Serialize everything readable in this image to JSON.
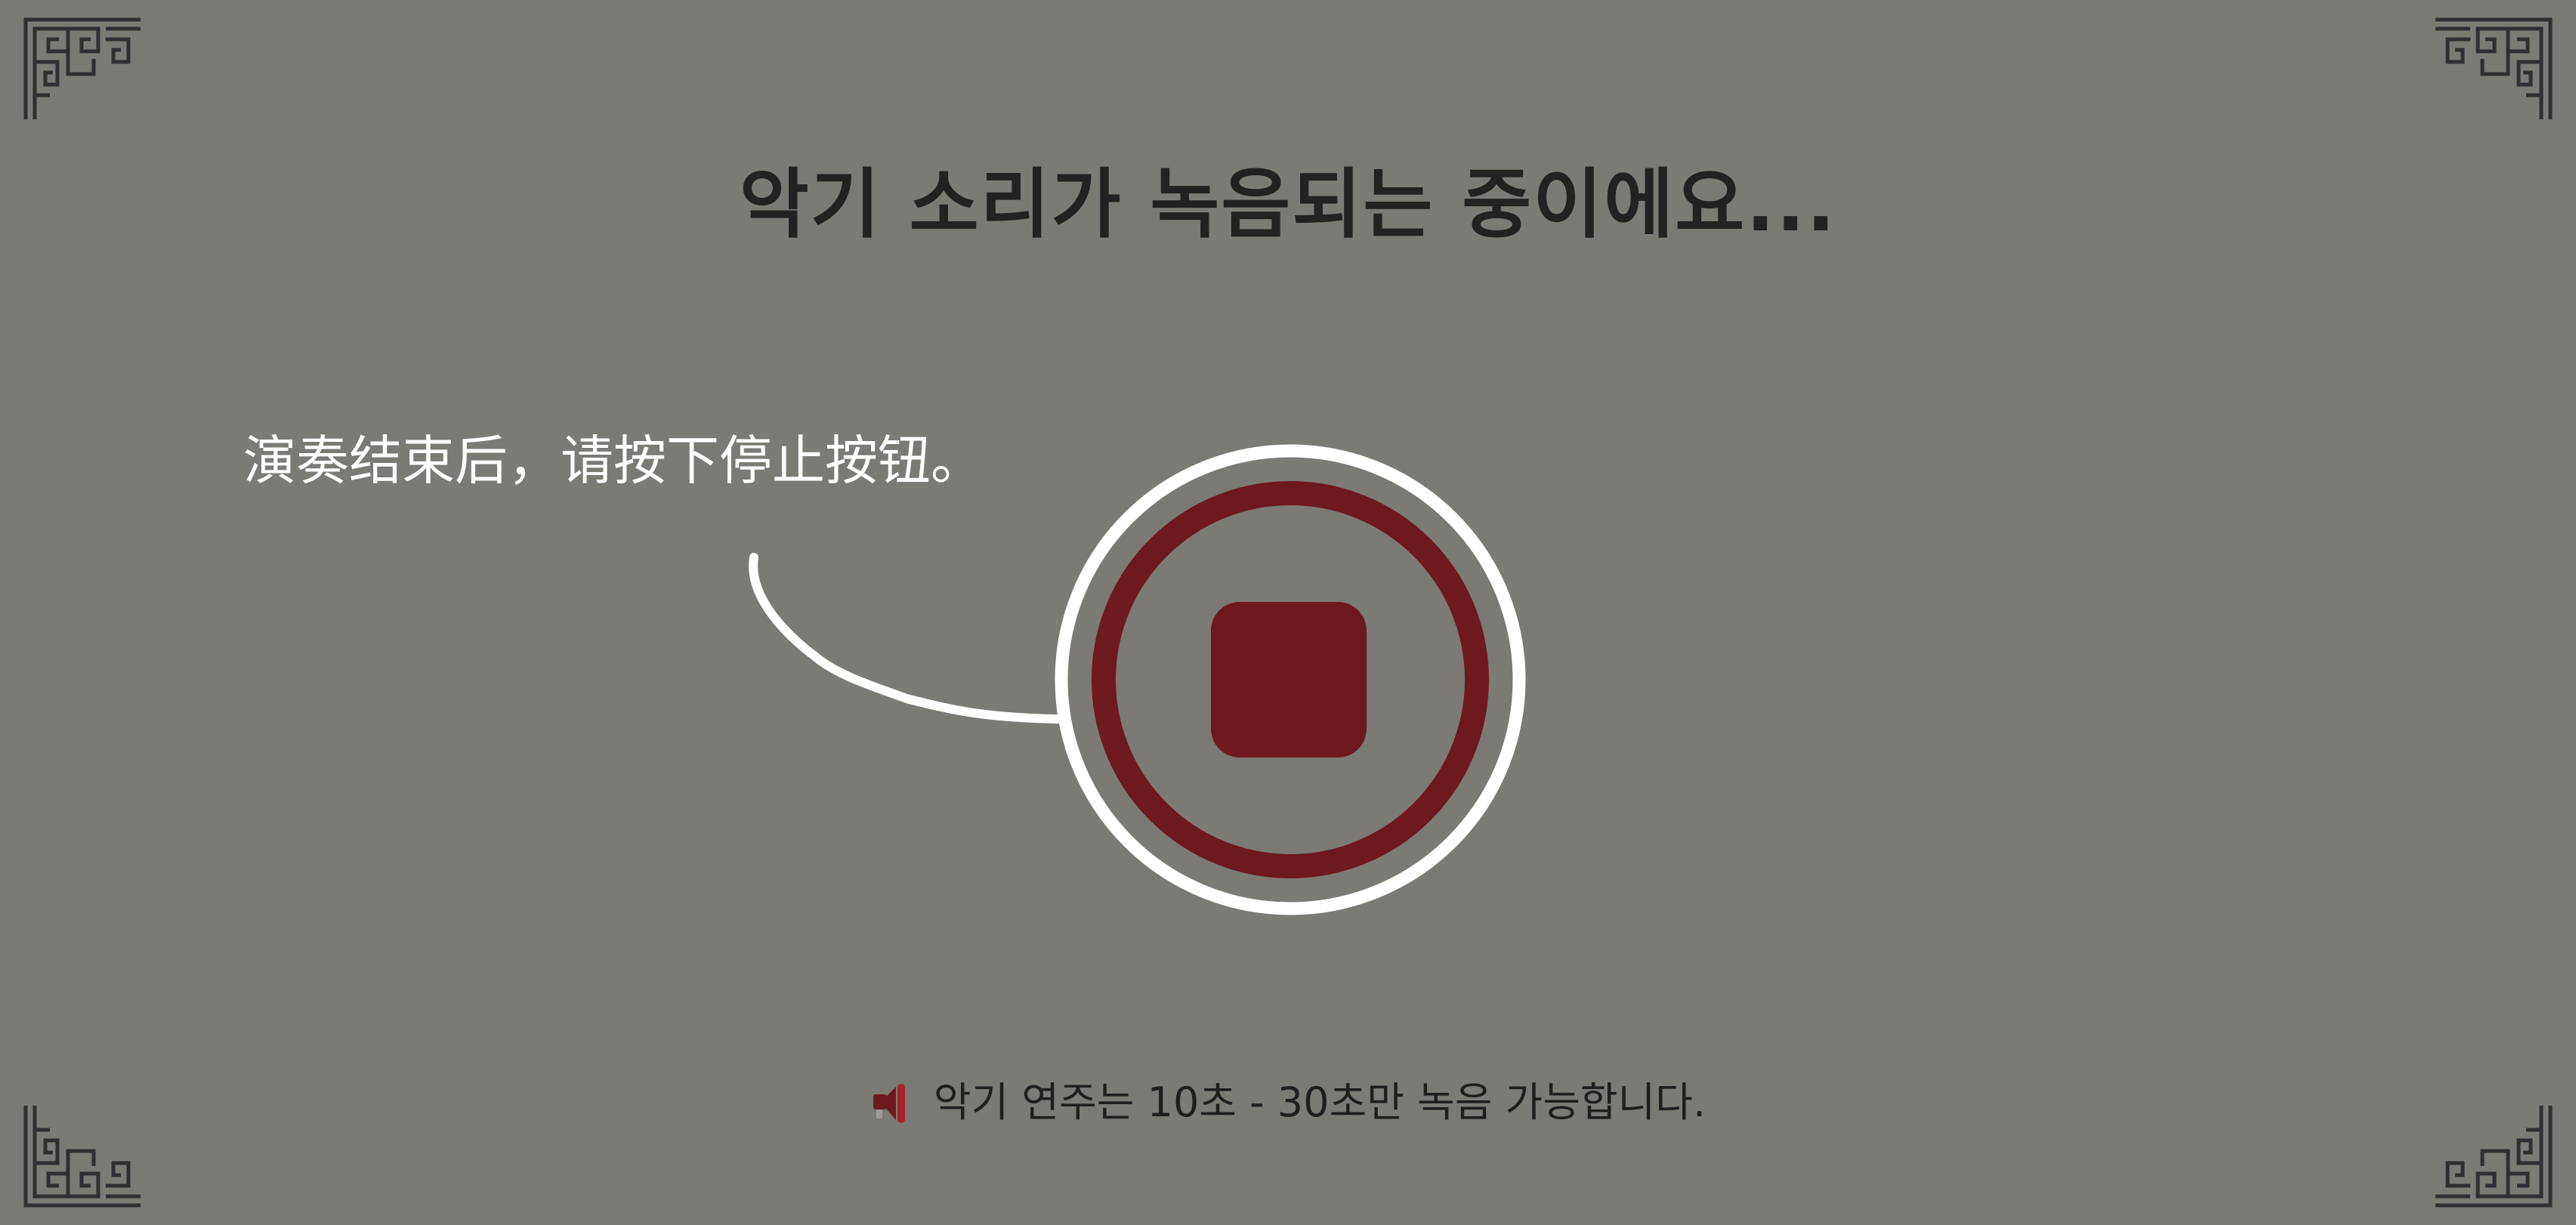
{
  "title": "악기 소리가 녹음되는 중이에요...",
  "hint": "演奏结束后，请按下停止按钮。",
  "stop_button": {
    "icon": "stop-icon",
    "ring_color": "#ffffff",
    "accent_color": "#6e1820"
  },
  "notice": {
    "icon": "megaphone-icon",
    "text": "악기 연주는 10초 - 30초만 녹음 가능합니다."
  },
  "colors": {
    "background": "#7b7a75",
    "title": "#222222",
    "ornament": "#2f2f33"
  }
}
